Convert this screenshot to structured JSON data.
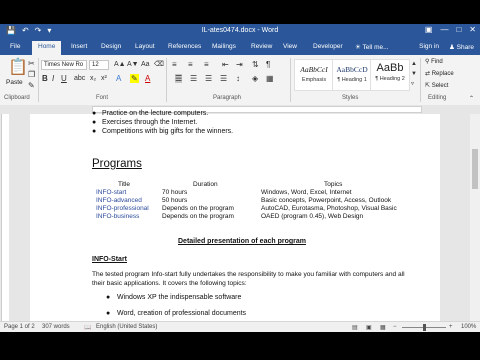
{
  "titlebar": {
    "title": "IL-ates0474.docx - Word",
    "qa_icons": [
      "save-icon",
      "undo-icon",
      "redo-icon",
      "customize-icon"
    ],
    "window_buttons": [
      "ribbon-options-icon",
      "minimize-icon",
      "maximize-icon",
      "close-icon"
    ]
  },
  "tabs": {
    "file": "File",
    "items": [
      "Home",
      "Insert",
      "Design",
      "Layout",
      "References",
      "Mailings",
      "Review",
      "View",
      "Developer"
    ],
    "tell_me": "Tell me...",
    "sign_in": "Sign in",
    "share": "Share"
  },
  "ribbon": {
    "paste_label": "Paste",
    "font_name": "Times New Ro",
    "font_size": "12",
    "styles": [
      {
        "sample": "AaBbCcI",
        "name": "Emphasis"
      },
      {
        "sample": "AaBbCcD",
        "name": "¶ Heading 1"
      },
      {
        "sample": "AaBb",
        "name": "¶ Heading 2"
      }
    ],
    "find": "Find",
    "replace": "Replace",
    "select": "Select",
    "groups": {
      "clipboard": "Clipboard",
      "font": "Font",
      "paragraph": "Paragraph",
      "styles": "Styles",
      "editing": "Editing"
    }
  },
  "document": {
    "top_bullets": [
      "Practice on the lecture computers.",
      "Exercises through the Internet.",
      "Competitions with big gifts for the winners."
    ],
    "heading": "Programs",
    "table": {
      "headers": [
        "Title",
        "Duration",
        "Topics"
      ],
      "rows": [
        [
          "INFO-start",
          "70 hours",
          "Windows, Word, Excel, Internet"
        ],
        [
          "INFO-advanced",
          "50 hours",
          "Basic concepts, Powerpoint, Access, Outlook"
        ],
        [
          "INFO-professional",
          "Depends on the program",
          "AutoCAD, Eurotasma, Photoshop, Visual Basic"
        ],
        [
          "INFO-business",
          "Depends on the program",
          "OAED (program 0.45), Web Design"
        ]
      ]
    },
    "section_title": "Detailed presentation of each program",
    "subheading": "INFO-Start",
    "paragraph": "The tested program Info-start fully undertakes the responsibility to make you familiar with computers and all their basic applications. It covers the following topics:",
    "bottom_bullets": [
      "Windows XP the indispensable software",
      "Word, creation of professional documents"
    ]
  },
  "status": {
    "page": "Page 1 of 2",
    "words": "307 words",
    "language": "English (United States)",
    "zoom": "100%"
  }
}
